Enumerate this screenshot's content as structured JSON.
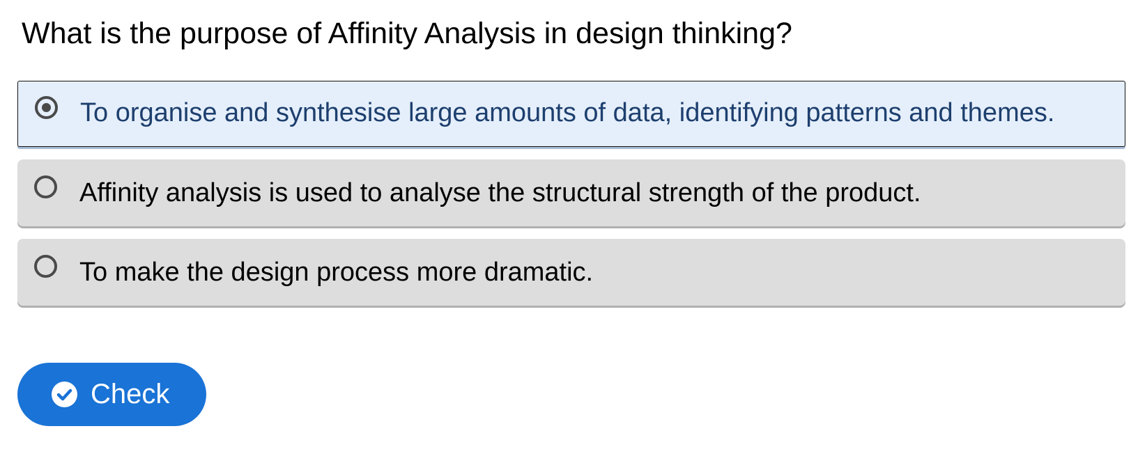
{
  "question": {
    "text": "What is the purpose of Affinity Analysis in design thinking?"
  },
  "options": [
    {
      "label": "To organise and synthesise large amounts of data, identifying patterns and themes.",
      "selected": true
    },
    {
      "label": "Affinity analysis is used to analyse the structural strength of the product.",
      "selected": false
    },
    {
      "label": "To make the design process more dramatic.",
      "selected": false
    }
  ],
  "check_button": {
    "label": "Check",
    "icon": "check-circle-icon"
  },
  "colors": {
    "selected_background": "#e5effb",
    "selected_text": "#1d3f6e",
    "option_background": "#dddddd",
    "button_background": "#1a73d6",
    "radio_color": "#4a4a4a"
  }
}
